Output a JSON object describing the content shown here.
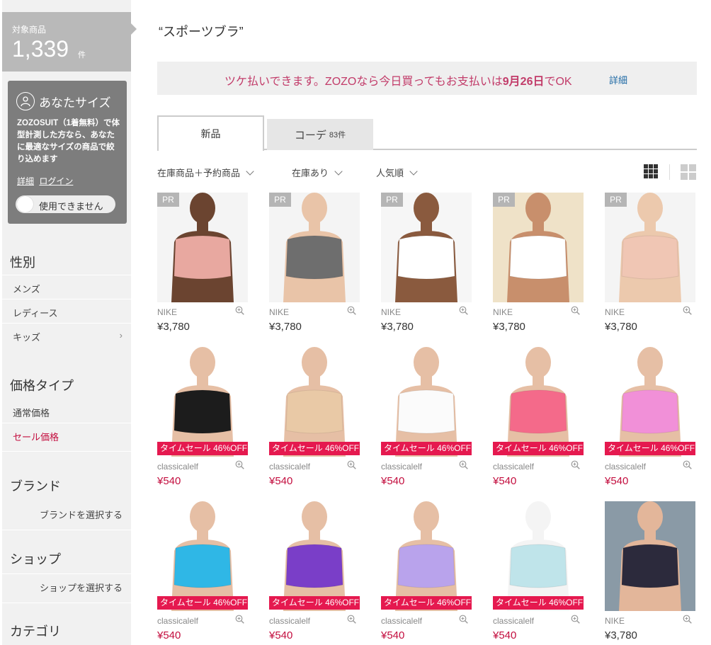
{
  "sidebar": {
    "count_label": "対象商品",
    "count_value": "1,339",
    "count_unit": "件",
    "size_title": "あなたサイズ",
    "size_desc": "ZOZOSUIT（1着無料）で体型計測した方なら、あなたに最適なサイズの商品で絞り込めます",
    "link_detail": "詳細",
    "link_login": "ログイン",
    "toggle_label": "使用できません",
    "gender_heading": "性別",
    "gender_items": [
      "メンズ",
      "レディース",
      "キッズ"
    ],
    "price_heading": "価格タイプ",
    "price_items": [
      "通常価格",
      "セール価格"
    ],
    "brand_heading": "ブランド",
    "brand_select": "ブランドを選択する",
    "shop_heading": "ショップ",
    "shop_select": "ショップを選択する",
    "category_heading": "カテゴリ"
  },
  "main": {
    "search_term": "“スポーツブラ”",
    "banner_pre": "ツケ払いできます。ZOZOなら今日買ってもお支払いは",
    "banner_date": "9月26日",
    "banner_post": "でOK",
    "banner_link": "詳細",
    "tab_new": "新品",
    "tab_coord": "コーデ",
    "tab_coord_count": "83件",
    "sort_stock_type": "在庫商品＋予約商品",
    "sort_in_stock": "在庫あり",
    "sort_order": "人気順"
  },
  "products": [
    {
      "brand": "NIKE",
      "price": "¥3,780",
      "pr": "PR",
      "sale": "",
      "skin": "#6b4430",
      "bra": "#e8a8a0",
      "bg": "#f4f4f4"
    },
    {
      "brand": "NIKE",
      "price": "¥3,780",
      "pr": "PR",
      "sale": "",
      "skin": "#e9c4a8",
      "bra": "#6e6e6e",
      "bg": "#f4f4f4"
    },
    {
      "brand": "NIKE",
      "price": "¥3,780",
      "pr": "PR",
      "sale": "",
      "skin": "#8a5a3e",
      "bra": "#ffffff",
      "bg": "#f6f6f6"
    },
    {
      "brand": "NIKE",
      "price": "¥3,780",
      "pr": "PR",
      "sale": "",
      "skin": "#c88f6c",
      "bra": "#ffffff",
      "bg": "#efe2c8"
    },
    {
      "brand": "NIKE",
      "price": "¥3,780",
      "pr": "PR",
      "sale": "",
      "skin": "#ecc9ad",
      "bra": "#f0c6b4",
      "bg": "#f4f4f4"
    },
    {
      "brand": "classicalelf",
      "price": "¥540",
      "pr": "",
      "sale": "タイムセール 46%OFF",
      "skin": "#e6bfa5",
      "bra": "#1c1c1c",
      "bg": "#ffffff"
    },
    {
      "brand": "classicalelf",
      "price": "¥540",
      "pr": "",
      "sale": "タイムセール 46%OFF",
      "skin": "#e6bfa5",
      "bra": "#e9c9a6",
      "bg": "#ffffff"
    },
    {
      "brand": "classicalelf",
      "price": "¥540",
      "pr": "",
      "sale": "タイムセール 46%OFF",
      "skin": "#e6bfa5",
      "bra": "#fbfbfb",
      "bg": "#ffffff"
    },
    {
      "brand": "classicalelf",
      "price": "¥540",
      "pr": "",
      "sale": "タイムセール 46%OFF",
      "skin": "#e6bfa5",
      "bra": "#f46a8a",
      "bg": "#ffffff"
    },
    {
      "brand": "classicalelf",
      "price": "¥540",
      "pr": "",
      "sale": "タイムセール 46%OFF",
      "skin": "#e6bfa5",
      "bra": "#f190d8",
      "bg": "#ffffff"
    },
    {
      "brand": "classicalelf",
      "price": "¥540",
      "pr": "",
      "sale": "タイムセール 46%OFF",
      "skin": "#e6bfa5",
      "bra": "#2fb7e6",
      "bg": "#ffffff"
    },
    {
      "brand": "classicalelf",
      "price": "¥540",
      "pr": "",
      "sale": "タイムセール 46%OFF",
      "skin": "#e6bfa5",
      "bra": "#7a3ec8",
      "bg": "#ffffff"
    },
    {
      "brand": "classicalelf",
      "price": "¥540",
      "pr": "",
      "sale": "タイムセール 46%OFF",
      "skin": "#e6bfa5",
      "bra": "#b9a3ec",
      "bg": "#ffffff"
    },
    {
      "brand": "classicalelf",
      "price": "¥540",
      "pr": "",
      "sale": "タイムセール 46%OFF",
      "skin": "#f4f4f4",
      "bra": "#bfe4ea",
      "bg": "#ffffff"
    },
    {
      "brand": "NIKE",
      "price": "¥3,780",
      "pr": "",
      "sale": "",
      "skin": "#e3b69a",
      "bra": "#2c2a3c",
      "bg": "#8a9aa6"
    }
  ]
}
